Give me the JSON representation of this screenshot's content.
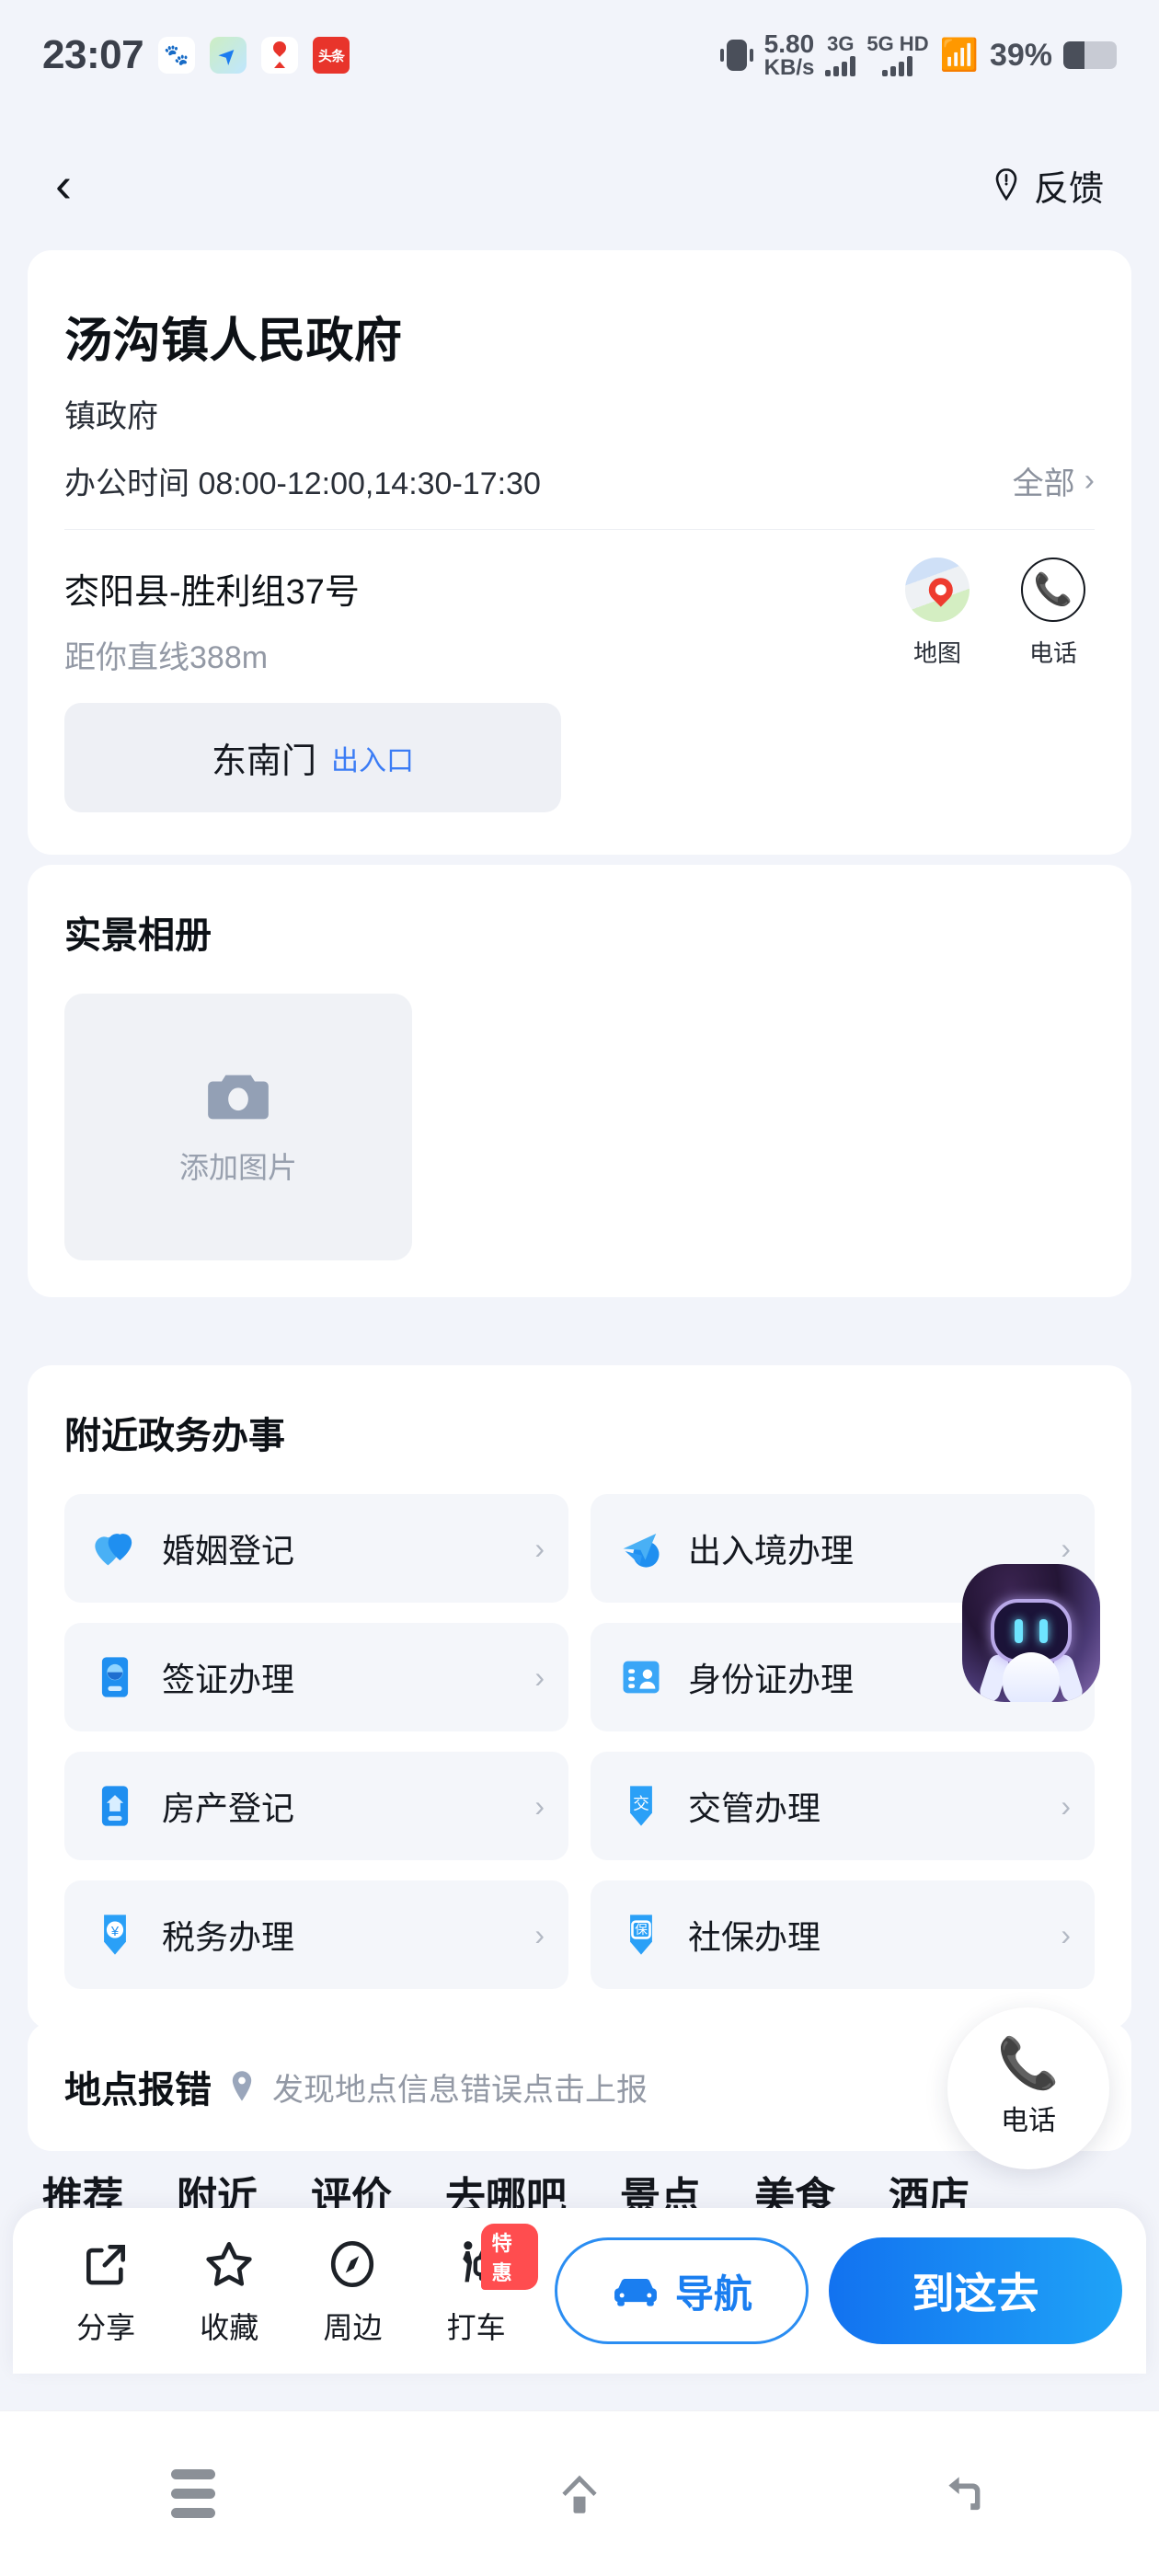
{
  "status_bar": {
    "time": "23:07",
    "app_icons": [
      "baidu-icon",
      "plane-icon",
      "map-pin-icon",
      "toutiao-icon"
    ],
    "net_speed_value": "5.80",
    "net_speed_unit": "KB/s",
    "sim1_label": "3G",
    "sim2_label": "5G HD",
    "battery_percent": "39%"
  },
  "header": {
    "back_label": "‹",
    "feedback_label": "反馈"
  },
  "poi": {
    "title": "汤沟镇人民政府",
    "category": "镇政府",
    "hours": "办公时间 08:00-12:00,14:30-17:30",
    "all_label": "全部",
    "address": "枩阳县-胜利组37号",
    "distance": "距你直线388m",
    "actions": [
      {
        "label": "地图",
        "icon": "map-icon"
      },
      {
        "label": "电话",
        "icon": "phone-icon"
      }
    ],
    "gate_name": "东南门",
    "gate_tag": "出入口"
  },
  "album": {
    "title": "实景相册",
    "add_label": "添加图片",
    "add_icon": "camera-icon"
  },
  "services": {
    "title": "附近政务办事",
    "items": [
      {
        "label": "婚姻登记",
        "icon": "hearts-icon",
        "color": "#2f9bf5"
      },
      {
        "label": "出入境办理",
        "icon": "airplane-icon",
        "color": "#2f9bf5"
      },
      {
        "label": "签证办理",
        "icon": "visa-card-icon",
        "color": "#1f8ff0"
      },
      {
        "label": "身份证办理",
        "icon": "id-card-icon",
        "color": "#3aa6f7"
      },
      {
        "label": "房产登记",
        "icon": "house-card-icon",
        "color": "#1f8ff0"
      },
      {
        "label": "交管办理",
        "icon": "traffic-shield-icon",
        "color": "#2aa0f7"
      },
      {
        "label": "税务办理",
        "icon": "tax-shield-icon",
        "color": "#2aa0f7"
      },
      {
        "label": "社保办理",
        "icon": "social-security-icon",
        "color": "#2aa0f7"
      }
    ],
    "chevron": "›"
  },
  "report": {
    "title": "地点报错",
    "desc": "发现地点信息错误点击上报",
    "pin_icon": "location-pin-icon"
  },
  "tabs": [
    "推荐",
    "附近",
    "评价",
    "去哪吧",
    "景点",
    "美食",
    "酒店"
  ],
  "floating": {
    "ai_assistant_icon": "ai-robot-icon",
    "phone_fab_label": "电话",
    "phone_fab_icon": "phone-icon"
  },
  "bottom_bar": {
    "items": [
      {
        "label": "分享",
        "icon": "share-icon",
        "badge": ""
      },
      {
        "label": "收藏",
        "icon": "star-icon",
        "badge": ""
      },
      {
        "label": "周边",
        "icon": "compass-icon",
        "badge": ""
      },
      {
        "label": "打车",
        "icon": "taxi-icon",
        "badge": "特惠"
      }
    ],
    "navigate_label": "导航",
    "navigate_icon": "car-icon",
    "go_label": "到这去",
    "accent": "#1a7ef0"
  },
  "system_nav": {
    "recents_icon": "menu-icon",
    "home_icon": "home-icon",
    "back_icon": "back-arrow-icon"
  }
}
